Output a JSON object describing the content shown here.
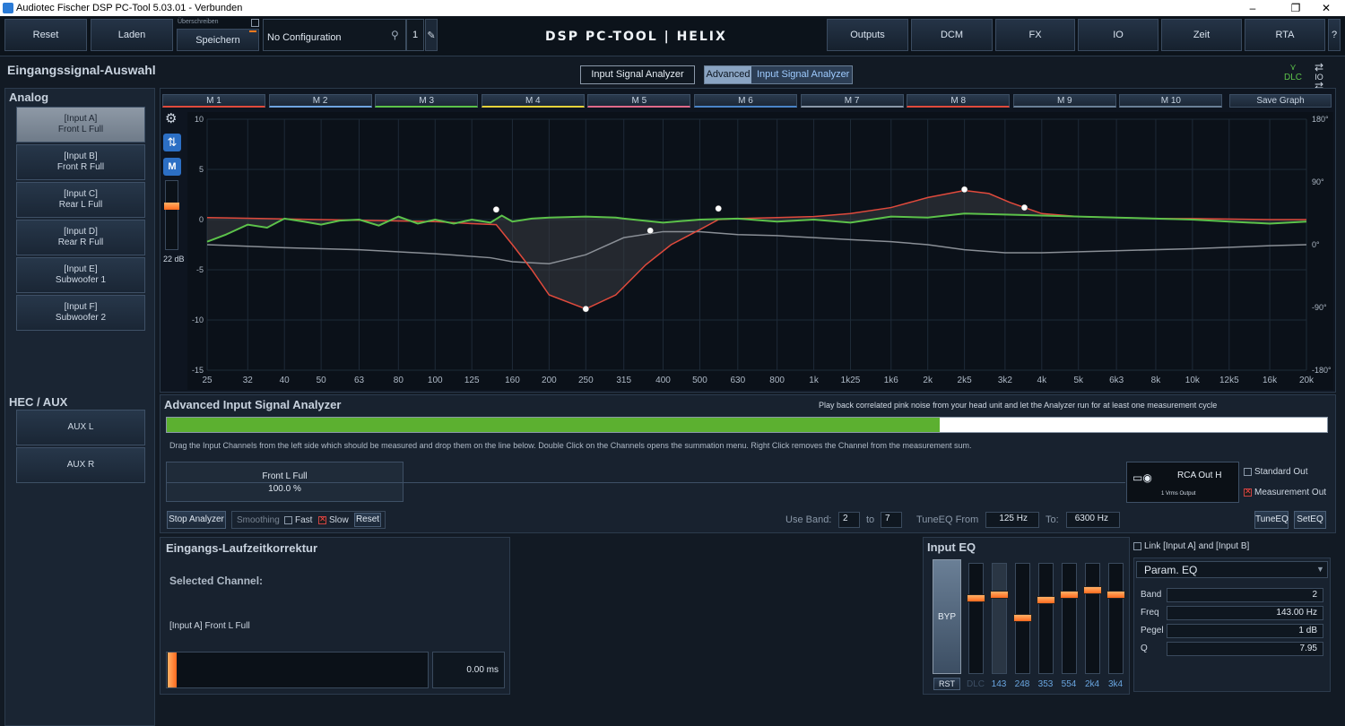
{
  "window": {
    "title": "Audiotec Fischer DSP PC-Tool 5.03.01 - Verbunden"
  },
  "toolbar": {
    "reset": "Reset",
    "laden": "Laden",
    "overwrite_label": "Überschreiben",
    "speichern": "Speichern",
    "config_name": "No Configuration",
    "config_number": "1",
    "logo": "DSP PC-TOOL | HELIX",
    "outputs": "Outputs",
    "dcm": "DCM",
    "fx": "FX",
    "io": "IO",
    "zeit": "Zeit",
    "rta": "RTA",
    "help": "?"
  },
  "left": {
    "title": "Eingangssignal-Auswahl",
    "analog_header": "Analog",
    "inputs": [
      {
        "id": "[Input A]",
        "name": "Front L Full"
      },
      {
        "id": "[Input B]",
        "name": "Front R Full"
      },
      {
        "id": "[Input C]",
        "name": "Rear L Full"
      },
      {
        "id": "[Input D]",
        "name": "Rear R Full"
      },
      {
        "id": "[Input E]",
        "name": "Subwoofer 1"
      },
      {
        "id": "[Input F]",
        "name": "Subwoofer 2"
      }
    ],
    "hec_header": "HEC / AUX",
    "aux": [
      "AUX L",
      "AUX R"
    ]
  },
  "modes": {
    "input_signal_analyzer": "Input Signal Analyzer",
    "advanced": "Advanced",
    "advanced_label": "Input Signal Analyzer",
    "dlc": "DLC",
    "io": "IO"
  },
  "graph": {
    "tabs": [
      "M 1",
      "M 2",
      "M 3",
      "M 4",
      "M 5",
      "M 6",
      "M 7",
      "M 8",
      "M 9",
      "M 10"
    ],
    "tab_colors": [
      "#e04a3c",
      "#6fa4e0",
      "#5cc24a",
      "#e6d23a",
      "#e06a8a",
      "#4a84c8",
      "#8a98a8",
      "#e04a3c",
      "#6a7f96",
      "#6a7f96"
    ],
    "save_graph": "Save Graph",
    "db_value": "22 dB",
    "y_ticks": [
      "10",
      "5",
      "0",
      "-5",
      "-10",
      "-15"
    ],
    "phase_ticks": [
      "180°",
      "90°",
      "0°",
      "-90°",
      "-180°"
    ],
    "x_ticks": [
      "25",
      "32",
      "40",
      "50",
      "63",
      "80",
      "100",
      "125",
      "160",
      "200",
      "250",
      "315",
      "400",
      "500",
      "630",
      "800",
      "1k",
      "1k25",
      "1k6",
      "2k",
      "2k5",
      "3k2",
      "4k",
      "5k",
      "6k3",
      "8k",
      "10k",
      "12k5",
      "16k",
      "20k"
    ]
  },
  "chart_data": {
    "type": "line",
    "xscale": "log",
    "ylim": [
      -15,
      10
    ],
    "series": [
      {
        "color": "#5cc24a",
        "points": [
          [
            25,
            -2.2
          ],
          [
            28,
            -1.5
          ],
          [
            32,
            -0.5
          ],
          [
            36,
            -0.8
          ],
          [
            40,
            0.1
          ],
          [
            45,
            -0.2
          ],
          [
            50,
            -0.5
          ],
          [
            56,
            -0.1
          ],
          [
            63,
            0
          ],
          [
            71,
            -0.6
          ],
          [
            80,
            0.3
          ],
          [
            90,
            -0.4
          ],
          [
            100,
            0
          ],
          [
            112,
            -0.4
          ],
          [
            125,
            0
          ],
          [
            140,
            -0.3
          ],
          [
            150,
            0.4
          ],
          [
            160,
            -0.2
          ],
          [
            180,
            0.1
          ],
          [
            200,
            0.2
          ],
          [
            250,
            0.3
          ],
          [
            300,
            0.2
          ],
          [
            315,
            0.1
          ],
          [
            400,
            -0.3
          ],
          [
            500,
            0
          ],
          [
            630,
            0.1
          ],
          [
            800,
            -0.2
          ],
          [
            1000,
            0
          ],
          [
            1250,
            -0.3
          ],
          [
            1600,
            0.3
          ],
          [
            2000,
            0.2
          ],
          [
            2500,
            0.6
          ],
          [
            3200,
            0.5
          ],
          [
            4000,
            0.4
          ],
          [
            5000,
            0.3
          ],
          [
            6300,
            0.2
          ],
          [
            8000,
            0.1
          ],
          [
            10000,
            0
          ],
          [
            12500,
            -0.2
          ],
          [
            16000,
            -0.4
          ],
          [
            20000,
            -0.2
          ]
        ]
      },
      {
        "color": "#e04a3c",
        "points": [
          [
            25,
            0.2
          ],
          [
            50,
            0
          ],
          [
            100,
            -0.2
          ],
          [
            125,
            -0.4
          ],
          [
            145,
            -0.5
          ],
          [
            160,
            -2.5
          ],
          [
            180,
            -5
          ],
          [
            200,
            -7.5
          ],
          [
            250,
            -8.9
          ],
          [
            300,
            -7.5
          ],
          [
            360,
            -4.5
          ],
          [
            420,
            -2.5
          ],
          [
            500,
            -1
          ],
          [
            560,
            0
          ],
          [
            630,
            0.1
          ],
          [
            800,
            0.2
          ],
          [
            1000,
            0.3
          ],
          [
            1250,
            0.6
          ],
          [
            1600,
            1.2
          ],
          [
            2000,
            2.2
          ],
          [
            2500,
            2.9
          ],
          [
            2900,
            2.6
          ],
          [
            3300,
            1.7
          ],
          [
            4000,
            0.6
          ],
          [
            5000,
            0.3
          ],
          [
            6300,
            0.2
          ],
          [
            8000,
            0.1
          ],
          [
            10000,
            0.1
          ],
          [
            16000,
            0
          ],
          [
            20000,
            0
          ]
        ]
      },
      {
        "color": "#8a8f96",
        "points": [
          [
            25,
            -2.5
          ],
          [
            40,
            -2.8
          ],
          [
            63,
            -3
          ],
          [
            100,
            -3.4
          ],
          [
            140,
            -3.8
          ],
          [
            160,
            -4.2
          ],
          [
            200,
            -4.4
          ],
          [
            250,
            -3.5
          ],
          [
            315,
            -1.8
          ],
          [
            400,
            -1.2
          ],
          [
            500,
            -1.2
          ],
          [
            630,
            -1.5
          ],
          [
            800,
            -1.6
          ],
          [
            1000,
            -1.8
          ],
          [
            1250,
            -2
          ],
          [
            1600,
            -2.2
          ],
          [
            2000,
            -2.5
          ],
          [
            2500,
            -3
          ],
          [
            3200,
            -3.3
          ],
          [
            4000,
            -3.3
          ],
          [
            6300,
            -3.1
          ],
          [
            10000,
            -2.9
          ],
          [
            16000,
            -2.6
          ],
          [
            20000,
            -2.5
          ]
        ]
      }
    ],
    "handles": [
      [
        145,
        1.0
      ],
      [
        250,
        -8.9
      ],
      [
        370,
        -1.1
      ],
      [
        560,
        1.1
      ],
      [
        2500,
        3.0
      ],
      [
        3600,
        1.2
      ]
    ]
  },
  "analyzer": {
    "title": "Advanced Input Signal Analyzer",
    "hint": "Play back correlated pink noise from your head unit and let the Analyzer run for at least one measurement cycle",
    "progress": 0.666,
    "instructions": "Drag the Input Channels from the left side which should be measured and drop them on the line below. Double Click on the Channels opens the summation menu. Right Click removes the Channel from the measurement sum.",
    "channel_name": "Front L Full",
    "channel_pct": "100.0 %",
    "rca_label": "RCA Out H",
    "rca_sub": "1 Vrms Output",
    "standard_out": "Standard Out",
    "measurement_out": "Measurement Out",
    "stop": "Stop Analyzer",
    "smoothing": "Smoothing",
    "fast": "Fast",
    "slow": "Slow",
    "reset": "Reset",
    "use_band": "Use Band:",
    "band_from": "2",
    "to_word": "to",
    "band_to": "7",
    "tune_from_label": "TuneEQ From",
    "tune_from": "125 Hz",
    "to_label": "To:",
    "tune_to": "6300 Hz",
    "tune_eq": "TuneEQ",
    "set_eq": "SetEQ"
  },
  "delay": {
    "title": "Eingangs-Laufzeitkorrektur",
    "selected": "Selected Channel:",
    "channel": "[Input A] Front L Full",
    "value": "0.00 ms"
  },
  "eq": {
    "title": "Input EQ",
    "link": "Link [Input A] and [Input B]",
    "type": "Param. EQ",
    "byp": "BYP",
    "rst": "RST",
    "dlc": "DLC",
    "bands": [
      "143",
      "248",
      "353",
      "554",
      "2k4",
      "3k4"
    ],
    "band_label": "Band",
    "band": "2",
    "freq_label": "Freq",
    "freq": "143.00 Hz",
    "pegel_label": "Pegel",
    "pegel": "1 dB",
    "q_label": "Q",
    "q": "7.95"
  }
}
